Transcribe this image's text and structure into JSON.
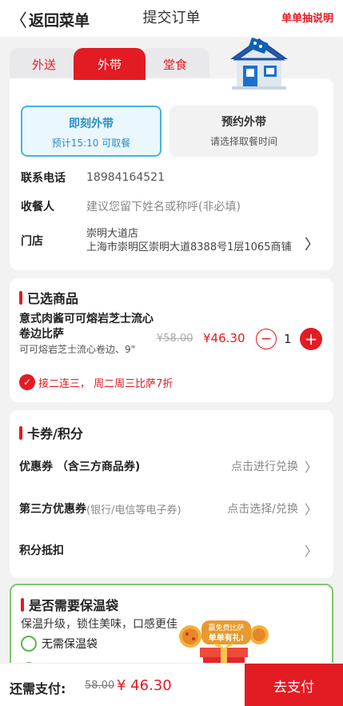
{
  "nav": {
    "back_label": "返回菜单",
    "title": "提交订单",
    "help_label": "单单抽说明"
  },
  "tabs": [
    {
      "label": "外送"
    },
    {
      "label": "外带"
    },
    {
      "label": "堂食"
    }
  ],
  "pickup": {
    "now": {
      "title": "即刻外带",
      "sub": "预计15:10 可取餐"
    },
    "reserve": {
      "title": "预约外带",
      "sub": "请选择取餐时间"
    }
  },
  "contact": {
    "phone_label": "联系电话",
    "phone": "18984164521",
    "name_label": "收餐人",
    "name_placeholder": "建议您留下姓名或称呼(非必填)"
  },
  "store": {
    "label": "门店",
    "name": "崇明大道店",
    "address": "上海市崇明区崇明大道8388号1层1065商铺"
  },
  "items": {
    "title": "已选商品",
    "product": {
      "name": "意式肉酱可可熔岩芝士流心卷边比萨",
      "desc": "可可熔岩芝士流心卷边、9\"",
      "old_price": "¥58.00",
      "price": "¥46.30",
      "qty": "1"
    },
    "promo": "接二连三， 周二周三比萨7折"
  },
  "coupons": {
    "title": "卡券/积分",
    "rows": [
      {
        "label": "优惠券 （含三方商品券)",
        "sub": "",
        "action": "点击进行兑换"
      },
      {
        "label": "第三方优惠券",
        "sub": " (银行/电信等电子券)",
        "action": "点击选择/兑换"
      },
      {
        "label": "积分抵扣",
        "sub": "",
        "action": ""
      }
    ]
  },
  "bag": {
    "title": "是否需要保温袋",
    "desc": "保温升级，锁住美味，口感更佳",
    "option_none": "无需保温袋"
  },
  "gift_banner": {
    "line1": "赢免费比萨",
    "line2": "单单有礼!"
  },
  "footer": {
    "label": "还需支付:",
    "old_total": "58.00",
    "total": "¥ 46.30",
    "pay_button": "去支付"
  },
  "colors": {
    "brand_red": "#e31b23",
    "accent_blue": "#45b3e0",
    "bag_green": "#7bc86c"
  }
}
